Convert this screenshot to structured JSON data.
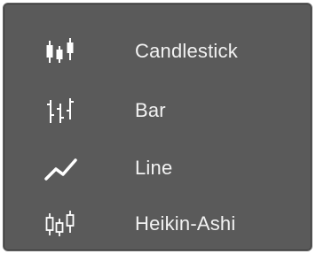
{
  "menu": {
    "items": [
      {
        "label": "Candlestick",
        "icon": "candlestick-chart-icon"
      },
      {
        "label": "Bar",
        "icon": "ohlc-bar-chart-icon"
      },
      {
        "label": "Line",
        "icon": "line-chart-icon"
      },
      {
        "label": "Heikin-Ashi",
        "icon": "heikin-ashi-chart-icon"
      }
    ]
  },
  "colors": {
    "background": "#5a5a5a",
    "text": "#f2f2f2",
    "icon": "#ffffff"
  }
}
